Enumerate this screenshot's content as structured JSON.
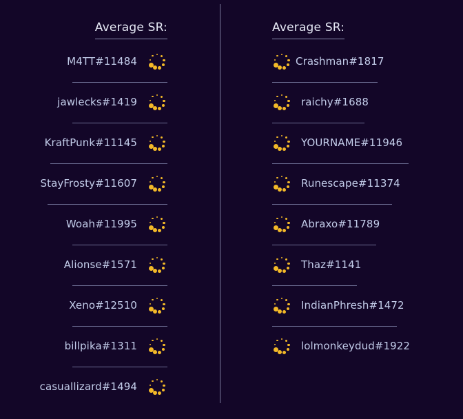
{
  "left_team": {
    "header": "Average SR:",
    "players": [
      {
        "name": "M4TT#11484"
      },
      {
        "name": "jawlecks#1419"
      },
      {
        "name": "KraftPunk#11145"
      },
      {
        "name": "StayFrosty#11607"
      },
      {
        "name": "Woah#11995"
      },
      {
        "name": "Alionse#1571"
      },
      {
        "name": "Xeno#12510"
      },
      {
        "name": "billpika#1311"
      },
      {
        "name": "casuallizard#1494"
      }
    ]
  },
  "right_team": {
    "header": "Average SR:",
    "players": [
      {
        "name": "Crashman#1817"
      },
      {
        "name": "raichy#1688"
      },
      {
        "name": "YOURNAME#11946"
      },
      {
        "name": "Runescape#11374"
      },
      {
        "name": "Abraxo#11789"
      },
      {
        "name": "Thaz#1141"
      },
      {
        "name": "IndianPhresh#1472"
      },
      {
        "name": "lolmonkeydud#1922"
      }
    ]
  },
  "icons": {
    "loading": "loading-spinner-icon"
  },
  "colors": {
    "background": "#130628",
    "spinner": "#f3b928",
    "text": "#c3cdea",
    "divider": "#7a7b9c"
  }
}
